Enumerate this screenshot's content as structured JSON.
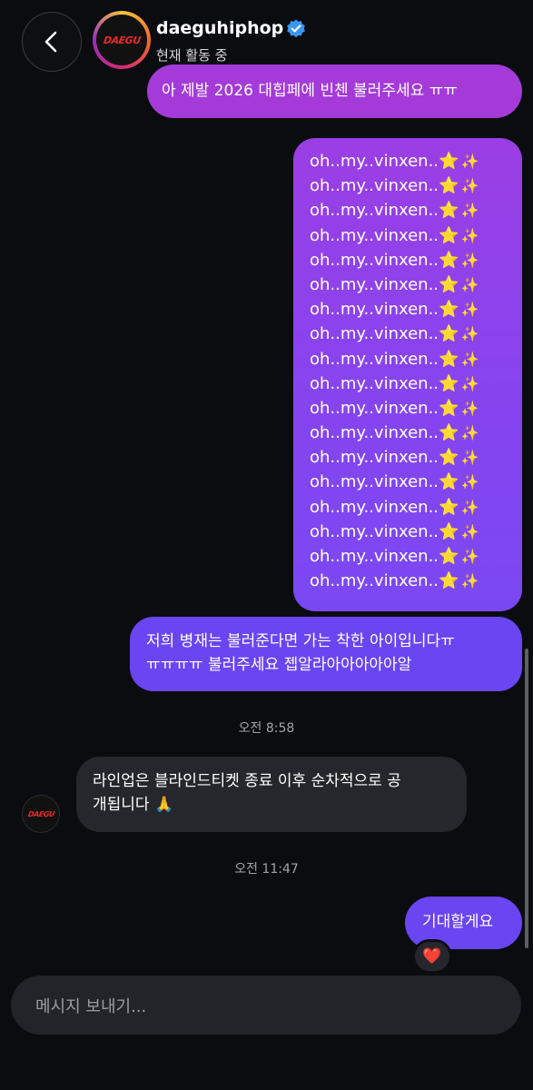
{
  "header": {
    "username": "daeguhiphop",
    "status": "현재 활동 중",
    "logo_text": "DAEGU",
    "back_icon": "chevron-left-icon",
    "verified_icon": "verified-badge-icon",
    "verified_color": "#3897f0"
  },
  "messages": {
    "m1": "아 제발 2026 대힙페에 빈첸 불러주세요 ㅠㅠ",
    "m2_lines": [
      "oh..my..vinxen..",
      "oh..my..vinxen..",
      "oh..my..vinxen..",
      "oh..my..vinxen..",
      "oh..my..vinxen..",
      "oh..my..vinxen..",
      "oh..my..vinxen..",
      "oh..my..vinxen..",
      "oh..my..vinxen..",
      "oh..my..vinxen..",
      "oh..my..vinxen..",
      "oh..my..vinxen..",
      "oh..my..vinxen..",
      "oh..my..vinxen..",
      "oh..my..vinxen..",
      "oh..my..vinxen..",
      "oh..my..vinxen..",
      "oh..my..vinxen.."
    ],
    "m2_star": "⭐",
    "m2_sparkle": "✨",
    "m3_line1": "저희 병재는 불러준다면 가는 착한 아이입니다ㅠ",
    "m3_line2": "ㅠㅠㅠㅠ 불러주세요 젭알라아아아아아알",
    "time1": "오전 8:58",
    "m4_line1": "라인업은 블라인드티켓 종료 이후 순차적으로 공",
    "m4_line2": "개됩니다 🙏",
    "time2": "오전 11:47",
    "m5": "기대할게요",
    "reaction": "❤️"
  },
  "composer": {
    "placeholder": "메시지 보내기..."
  },
  "colors": {
    "background": "#0b0c10",
    "bubble_purple": "#a43bd8",
    "bubble_violet": "#6a45f2",
    "bubble_incoming": "#26272c"
  }
}
